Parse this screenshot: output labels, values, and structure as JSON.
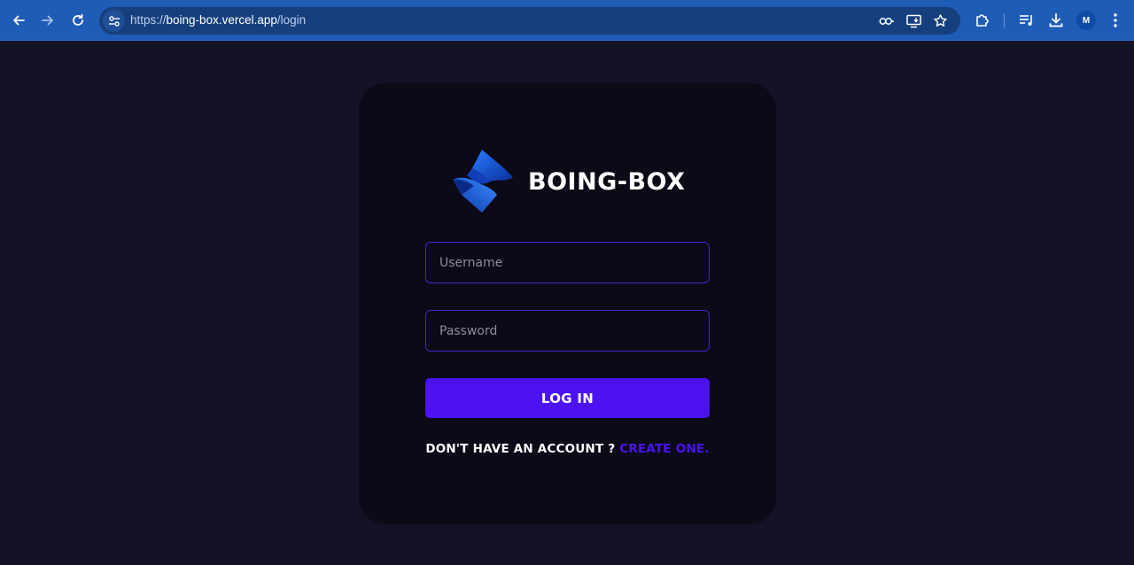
{
  "browser": {
    "url_prefix": "https://",
    "url_host": "boing-box.vercel.app",
    "url_path": "/login",
    "profile_initial": "M",
    "icons": {
      "back": "back-arrow-icon",
      "forward": "forward-arrow-icon",
      "reload": "reload-icon",
      "site_info": "site-settings-icon",
      "password": "key-icon",
      "install": "install-app-icon",
      "bookmark": "star-icon",
      "extensions": "puzzle-icon",
      "media": "media-control-icon",
      "downloads": "download-icon",
      "menu": "kebab-menu-icon"
    }
  },
  "login": {
    "brand_name": "BOING-BOX",
    "username_placeholder": "Username",
    "password_placeholder": "Password",
    "login_label": "LOG IN",
    "signup_prompt": "DON'T HAVE AN ACCOUNT ?",
    "signup_link": "CREATE ONE."
  },
  "colors": {
    "page_bg": "#141326",
    "card_bg": "#0b0a16",
    "accent": "#4c12f4",
    "toolbar": "#1f5cb6"
  }
}
